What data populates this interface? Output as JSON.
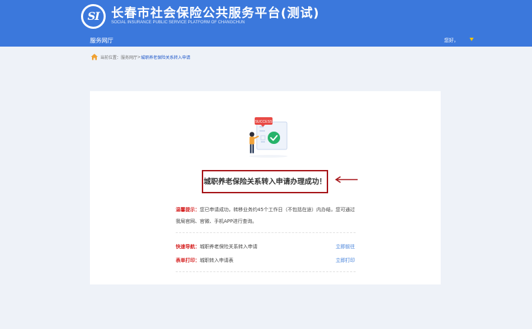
{
  "header": {
    "logo_text": "SI",
    "title": "长春市社会保险公共服务平台(测试)",
    "subtitle": "SOCIAL INSURANCE PUBLIC SERVICE PLATFORM OF CHANGCHUN",
    "nav_item": "服务网厅",
    "greeting": "您好，"
  },
  "breadcrumb": {
    "prefix": "当前位置：",
    "parent": "服务网厅",
    "separator": " > ",
    "current": "城职养老保险关系转入申请"
  },
  "result": {
    "badge_text": "SUCCESS",
    "message": "城职养老保险关系转入申请办理成功！"
  },
  "tip": {
    "label": "温馨提示：",
    "line1": "您已申请成功，转移业务约45个工作日（不包括在途）内办结，您可通过",
    "line2": "我局官网、官微、手机APP进行查询。"
  },
  "quick_nav": {
    "label": "快速导航：",
    "value": "城职养老保险关系转入申请",
    "link": "立即前往"
  },
  "print": {
    "label": "表单打印：",
    "value": "城职转入申请表",
    "link": "立即打印"
  },
  "colors": {
    "header_bg": "#3b78dc",
    "highlight_border": "#a7161a",
    "label_red": "#d51f1f",
    "link_blue": "#3b7bd8",
    "success_green": "#27b36a"
  }
}
